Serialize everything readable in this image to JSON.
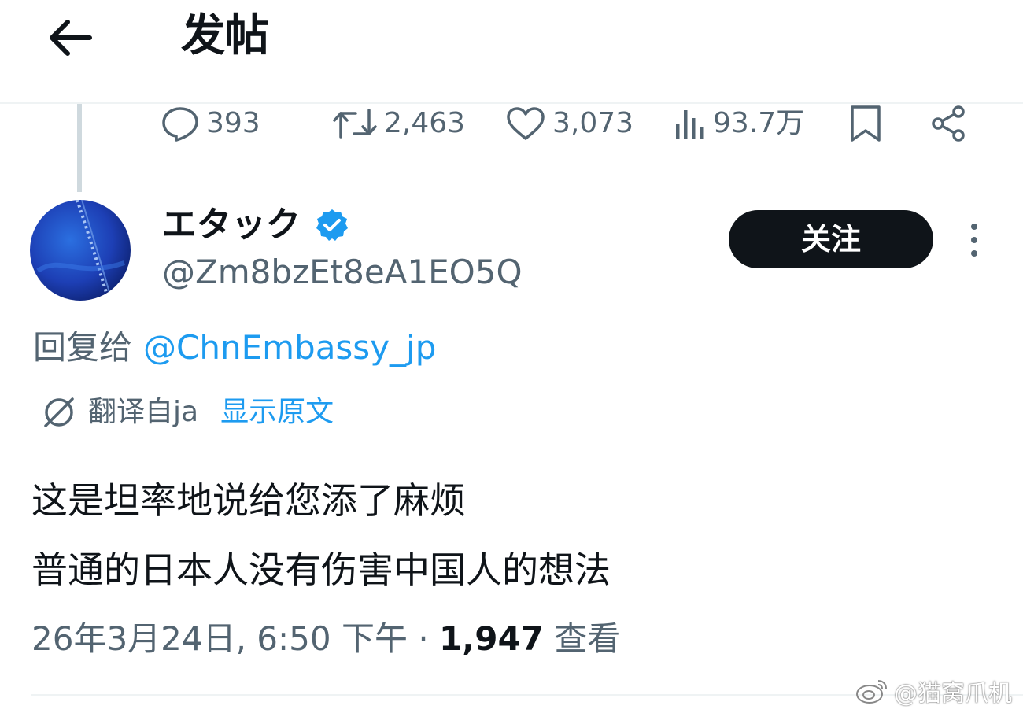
{
  "header": {
    "title": "发帖",
    "back_icon": "arrow-left-icon"
  },
  "actions": {
    "reply": {
      "icon": "reply-icon",
      "count": "393"
    },
    "repost": {
      "icon": "repost-icon",
      "count": "2,463"
    },
    "like": {
      "icon": "heart-icon",
      "count": "3,073"
    },
    "views": {
      "icon": "views-icon",
      "count": "93.7万"
    },
    "bookmark": {
      "icon": "bookmark-icon"
    },
    "share": {
      "icon": "share-icon"
    }
  },
  "author": {
    "display_name": "エタック",
    "handle": "@Zm8bzEt8eA1EO5Q",
    "verified": true,
    "verified_color": "#1d9bf0",
    "avatar_color": "#1d3fb5",
    "follow_label": "关注"
  },
  "reply_to": {
    "label": "回复给",
    "target": "@ChnEmbassy_jp"
  },
  "translation": {
    "label": "翻译自ja",
    "show_original": "显示原文"
  },
  "tweet": {
    "lines": [
      "这是坦率地说给您添了麻烦",
      "普通的日本人没有伤害中国人的想法"
    ]
  },
  "meta": {
    "timestamp": "26年3月24日, 6:50 下午",
    "separator": " · ",
    "view_count": "1,947",
    "view_label": "查看"
  },
  "watermark": {
    "text": "@猫窝爪机",
    "icon": "weibo-icon"
  },
  "colors": {
    "text_primary": "#0f1419",
    "text_secondary": "#536471",
    "link": "#1d9bf0",
    "follow_button_bg": "#0f1419"
  }
}
